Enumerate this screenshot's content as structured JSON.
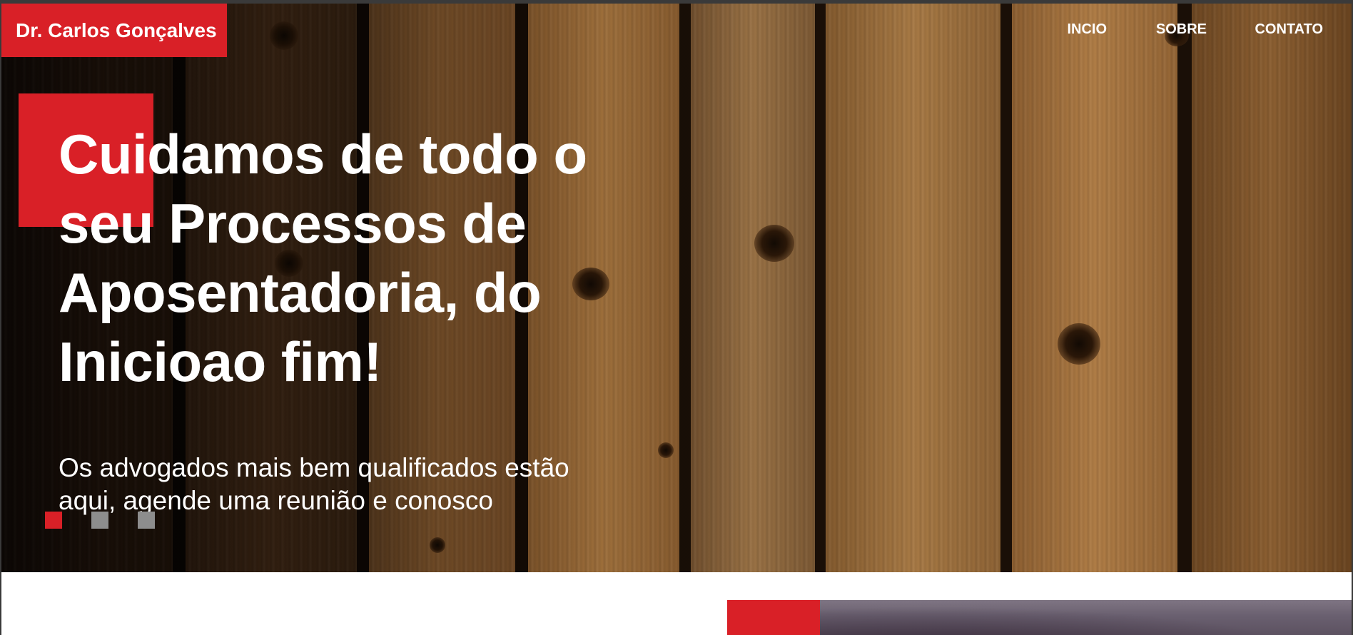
{
  "brand": {
    "name": "Dr. Carlos Gonçalves"
  },
  "nav": {
    "items": [
      {
        "label": "INCIO"
      },
      {
        "label": "SOBRE"
      },
      {
        "label": "CONTATO"
      }
    ]
  },
  "hero": {
    "headline": "Cuidamos de todo o seu Processos de Aposentadoria, do Inicioao fim!",
    "subtitle": "Os advogados mais bem qualificados estão aqui, agende uma reunião e conosco",
    "slides": {
      "count": 3,
      "active_index": 0
    }
  },
  "colors": {
    "accent": "#d92027",
    "dot_inactive": "#8d8d8d",
    "text_on_hero": "#ffffff"
  },
  "icons": {
    "hero_background": "wood-planks-image",
    "lower_image": "sky-photo"
  }
}
